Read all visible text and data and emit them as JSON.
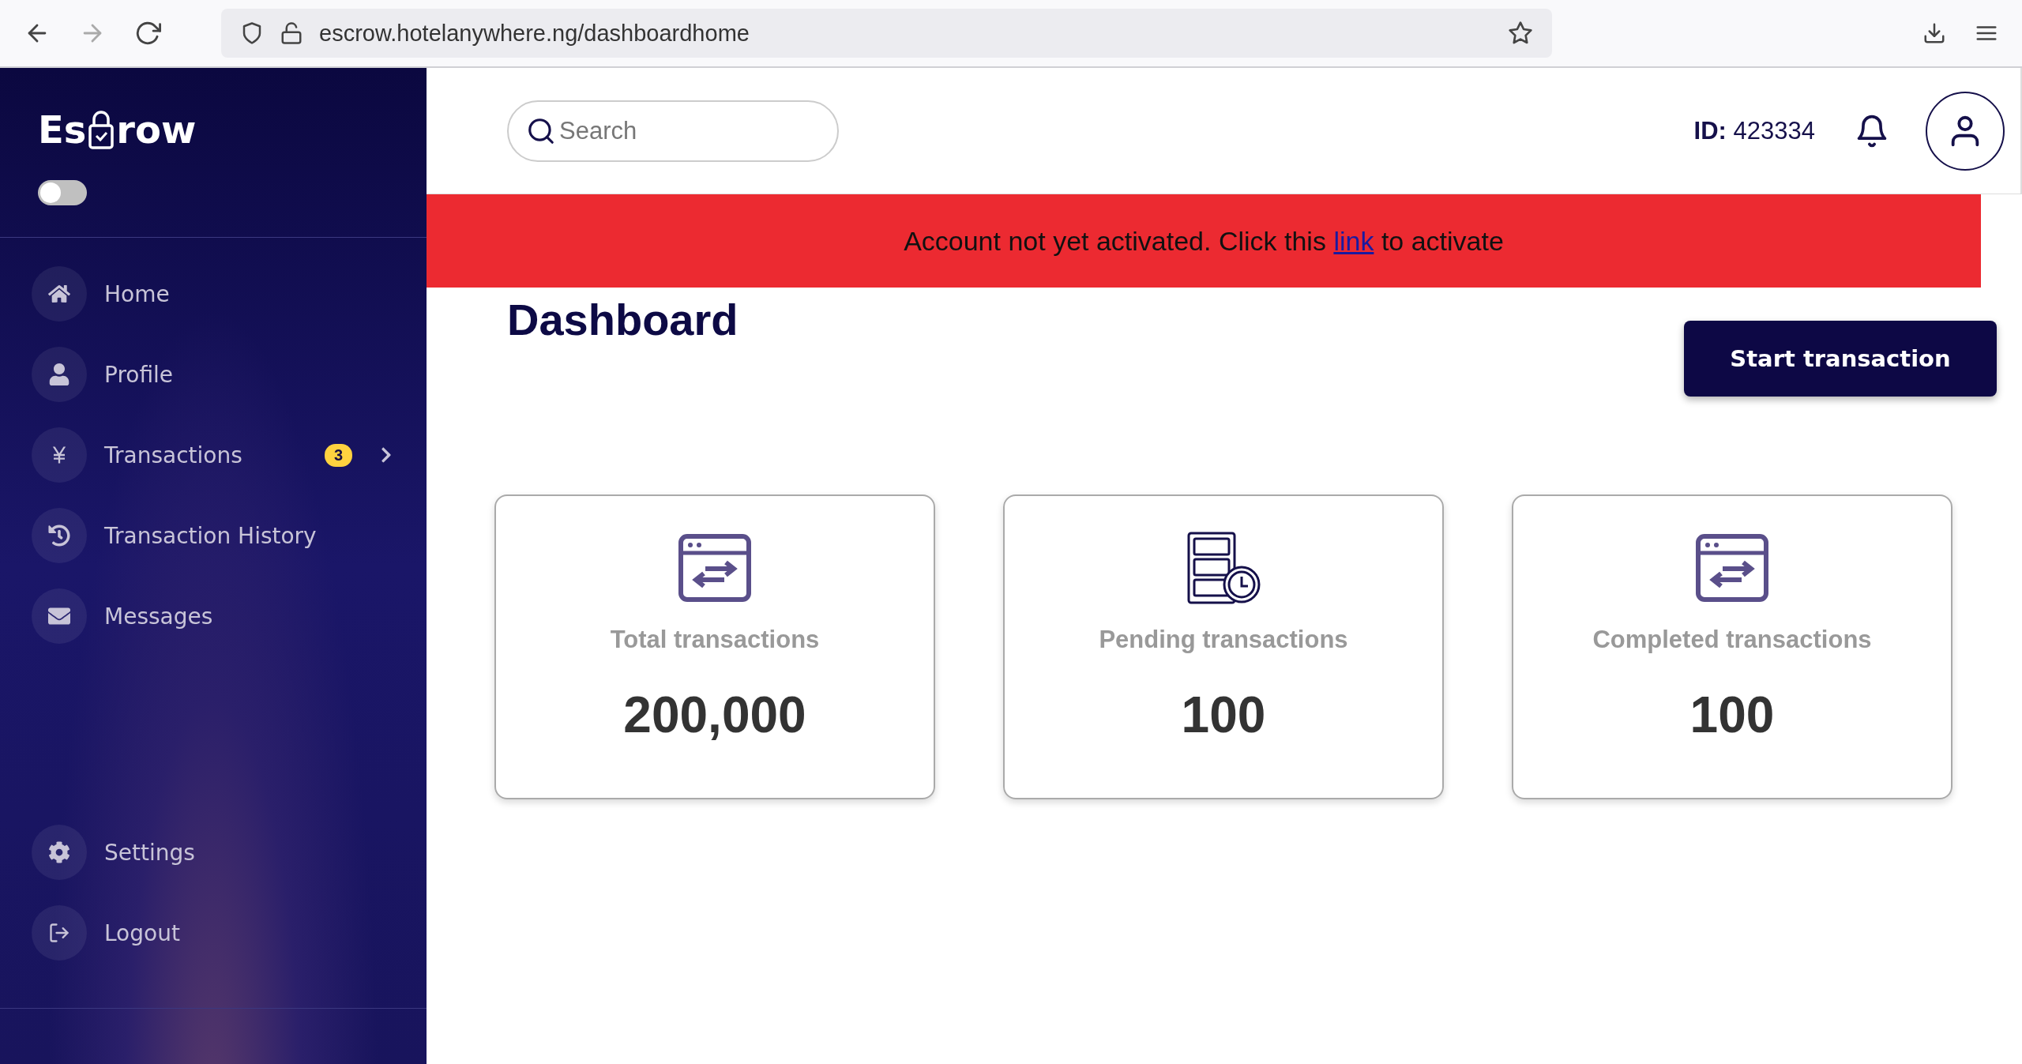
{
  "browser": {
    "url": "escrow.hotelanywhere.ng/dashboardhome"
  },
  "sidebar": {
    "logo": {
      "left": "Es",
      "right": "row"
    },
    "theme_toggle": {
      "on": false
    },
    "items": [
      {
        "label": "Home",
        "kind": "home"
      },
      {
        "label": "Profile",
        "kind": "profile"
      },
      {
        "label": "Transactions",
        "kind": "transactions",
        "badge": "3",
        "expanded": false
      },
      {
        "label": "Transaction History",
        "kind": "history"
      },
      {
        "label": "Messages",
        "kind": "messages"
      }
    ],
    "bottom_items": [
      {
        "label": "Settings",
        "kind": "settings"
      },
      {
        "label": "Logout",
        "kind": "logout"
      }
    ]
  },
  "header": {
    "search": {
      "placeholder": "Search"
    },
    "id_label": "ID:",
    "id_value": "423334"
  },
  "banner": {
    "before": "Account not yet activated. Click this",
    "link": "link",
    "after": "to activate"
  },
  "page": {
    "title": "Dashboard",
    "action": "Start transaction"
  },
  "cards": [
    {
      "kind": "exchange",
      "label": "Total transactions",
      "value": "200,000"
    },
    {
      "kind": "pending",
      "label": "Pending transactions",
      "value": "100"
    },
    {
      "kind": "exchange",
      "label": "Completed transactions",
      "value": "100"
    }
  ]
}
